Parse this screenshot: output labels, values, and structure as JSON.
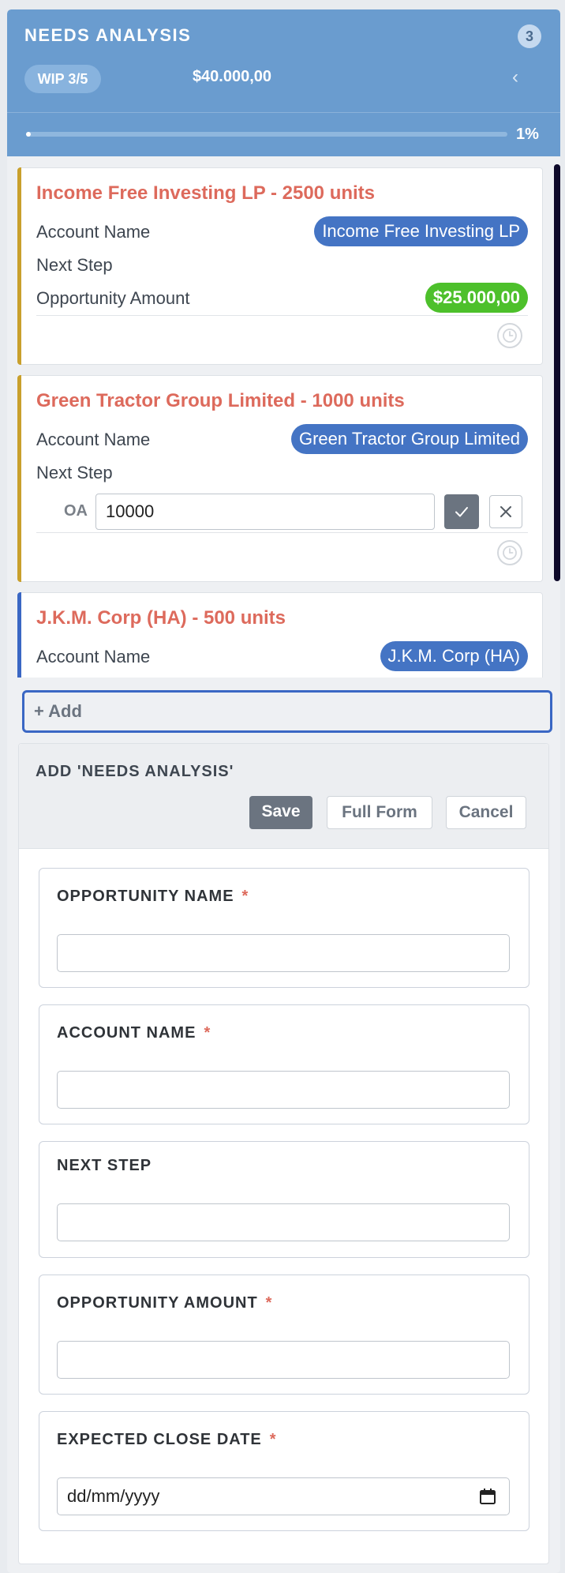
{
  "column": {
    "title": "NEEDS ANALYSIS",
    "count": "3",
    "wip": "WIP 3/5",
    "total": "$40.000,00",
    "collapse_glyph": "‹",
    "progress_percent": 1,
    "progress_text": "1%"
  },
  "cards": [
    {
      "title": "Income Free Investing LP - 2500 units",
      "account_label": "Account Name",
      "account_value": "Income Free Investing LP",
      "next_step_label": "Next Step",
      "amount_label": "Opportunity Amount",
      "amount_value": "$25.000,00"
    },
    {
      "title": "Green Tractor Group Limited - 1000 units",
      "account_label": "Account Name",
      "account_value": "Green Tractor Group Limited",
      "next_step_label": "Next Step",
      "inline_edit_label": "OA",
      "inline_edit_value": "10000"
    },
    {
      "title": "J.K.M. Corp (HA) - 500 units",
      "account_label": "Account Name",
      "account_value": "J.K.M. Corp (HA)"
    }
  ],
  "add_button_label": "+ Add",
  "form": {
    "title": "ADD 'NEEDS ANALYSIS'",
    "save_label": "Save",
    "full_form_label": "Full Form",
    "cancel_label": "Cancel",
    "required_marker": "*",
    "fields": [
      {
        "label": "OPPORTUNITY NAME",
        "required": true,
        "value": ""
      },
      {
        "label": "ACCOUNT NAME",
        "required": true,
        "value": ""
      },
      {
        "label": "NEXT STEP",
        "required": false,
        "value": ""
      },
      {
        "label": "OPPORTUNITY AMOUNT",
        "required": true,
        "value": ""
      },
      {
        "label": "EXPECTED CLOSE DATE",
        "required": true,
        "value": "dd/mm/yyyy"
      }
    ]
  },
  "colors": {
    "header": "#6a9ccf",
    "card_title": "#dd6a5c",
    "card_accent_yellow": "#c9a02c",
    "card_accent_blue": "#3a67c4",
    "pill_blue": "#4474c4",
    "pill_green": "#4dc02b",
    "required": "#dd6a5c"
  },
  "icons": {
    "clock": "clock-icon",
    "check": "check-icon",
    "close": "close-icon",
    "calendar": "calendar-icon",
    "collapse": "chevron-left-icon"
  }
}
